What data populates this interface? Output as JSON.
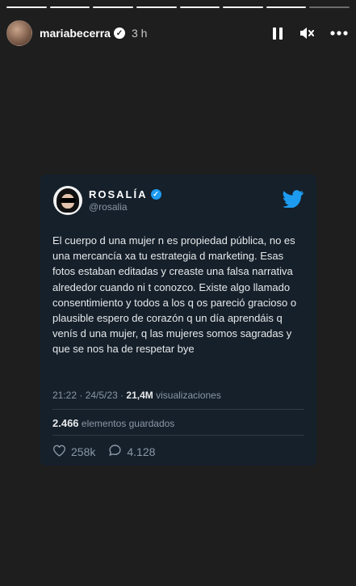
{
  "story": {
    "progress_segments_total": 8,
    "progress_segments_viewed": 7,
    "username": "mariabecerra",
    "time_ago": "3 h",
    "verified": true
  },
  "icons": {
    "pause": "pause-icon",
    "mute": "mute-icon",
    "more": "more-icon",
    "twitter": "twitter-bird-icon",
    "like": "heart-icon",
    "reply": "reply-icon"
  },
  "tweet": {
    "display_name": "ROSALÍA",
    "handle": "@rosalia",
    "text": "El cuerpo d una mujer n es propiedad pública, no es una mercancía xa tu estrategia d marketing. Esas fotos estaban editadas y creaste una falsa narrativa alrededor cuando ni t conozco. Existe algo llamado consentimiento y todos a los q os pareció gracioso o plausible espero de corazón q un día aprendáis q venís d una mujer, q las mujeres somos sagradas y que se nos ha de respetar bye",
    "time": "21:22",
    "date": "24/5/23",
    "views": "21,4M",
    "views_label": "visualizaciones",
    "saves": "2.466",
    "saves_label": "elementos guardados",
    "likes": "258k",
    "replies": "4.128"
  },
  "colors": {
    "background": "#1e1e1e",
    "card": "#15202b",
    "twitter_blue": "#1d9bf0",
    "muted_text": "#8b98a5"
  }
}
